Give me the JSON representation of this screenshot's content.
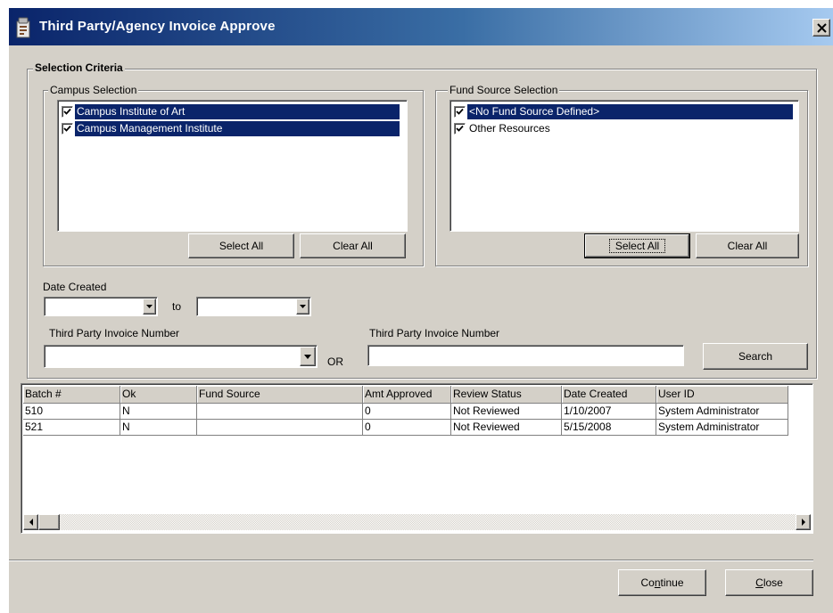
{
  "window": {
    "title": "Third Party/Agency Invoice Approve"
  },
  "selection_criteria": {
    "label": "Selection Criteria",
    "campus": {
      "label": "Campus Selection",
      "items": [
        {
          "label": "Campus Institute of Art",
          "checked": true,
          "selected": true
        },
        {
          "label": "Campus Management Institute",
          "checked": true,
          "selected": true
        }
      ],
      "select_all": "Select All",
      "clear_all": "Clear All"
    },
    "fund_source": {
      "label": "Fund Source Selection",
      "items": [
        {
          "label": "<No Fund Source Defined>",
          "checked": true,
          "selected": true
        },
        {
          "label": "Other Resources",
          "checked": true,
          "selected": false
        }
      ],
      "select_all": "Select All",
      "clear_all": "Clear All"
    },
    "date_created": {
      "label": "Date Created",
      "from_value": "",
      "to_label": "to",
      "to_value": ""
    },
    "invoice_combo": {
      "label": "Third Party Invoice  Number",
      "value": ""
    },
    "or_label": "OR",
    "invoice_text": {
      "label": "Third Party Invoice  Number",
      "value": ""
    },
    "search_label": "Search"
  },
  "grid": {
    "columns": [
      "Batch #",
      "Ok",
      "Fund Source",
      "Amt Approved",
      "Review Status",
      "Date Created",
      "User ID"
    ],
    "rows": [
      [
        "510",
        "N",
        "",
        "0",
        "Not Reviewed",
        "1/10/2007",
        "System Administrator"
      ],
      [
        "521",
        "N",
        "",
        "0",
        "Not Reviewed",
        "5/15/2008",
        "System Administrator"
      ]
    ]
  },
  "footer": {
    "continue_pre": "Co",
    "continue_key": "n",
    "continue_post": "tinue",
    "close_key": "C",
    "close_post": "lose"
  },
  "colors": {
    "face": "#d4d0c8",
    "title_start": "#0a246a",
    "title_end": "#a6caf0",
    "selection": "#0a246a"
  },
  "icons": {
    "title": "app-window-icon",
    "close": "close-x-icon",
    "check": "checkmark-icon",
    "dropdown": "dropdown-arrow-icon",
    "scroll_left": "scroll-left-arrow-icon",
    "scroll_right": "scroll-right-arrow-icon"
  }
}
